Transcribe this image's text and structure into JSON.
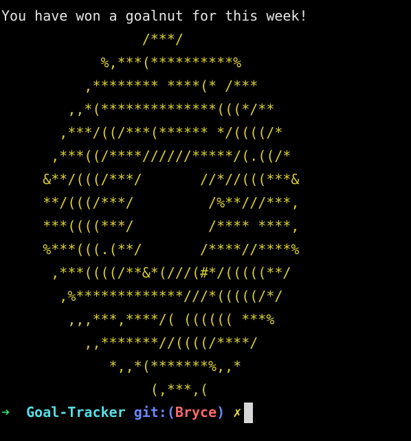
{
  "headline": "You have won a goalnut for this week!",
  "art_color": "#d9cf32",
  "art_lines": [
    "                 /***/",
    "            %,***(**********%",
    "          ,******** ****(* /***",
    "        ,,*(**************(((*/**",
    "       ,***/((/***(****** */((((/*",
    "      ,***((/****//////*****/(.((/*",
    "     &**/(((/***/       //*//(((***&",
    "     **/(((/***/         /%**///***,",
    "     ***((((***/         /**** ****,",
    "     %***(((.(**/       /****//****%",
    "      ,***((((/**&*(///(#*/(((((**/",
    "       ,%*************///*(((((/*/",
    "        ,,,***,****/( (((((( ***%",
    "          ,,*******//((((/****/",
    "             *,,*(*******%,,*",
    "                  (,***,("
  ],
  "prompt": {
    "arrow": "➜",
    "repo": "Goal-Tracker",
    "git_label": "git:",
    "paren_open": "(",
    "branch": "Bryce",
    "paren_close": ")",
    "dirty_mark": "✗",
    "colors": {
      "arrow": "#2fd66a",
      "repo": "#55e0e7",
      "git": "#6b86ff",
      "branch": "#ff6a6a",
      "dirty": "#e8e04b"
    }
  }
}
